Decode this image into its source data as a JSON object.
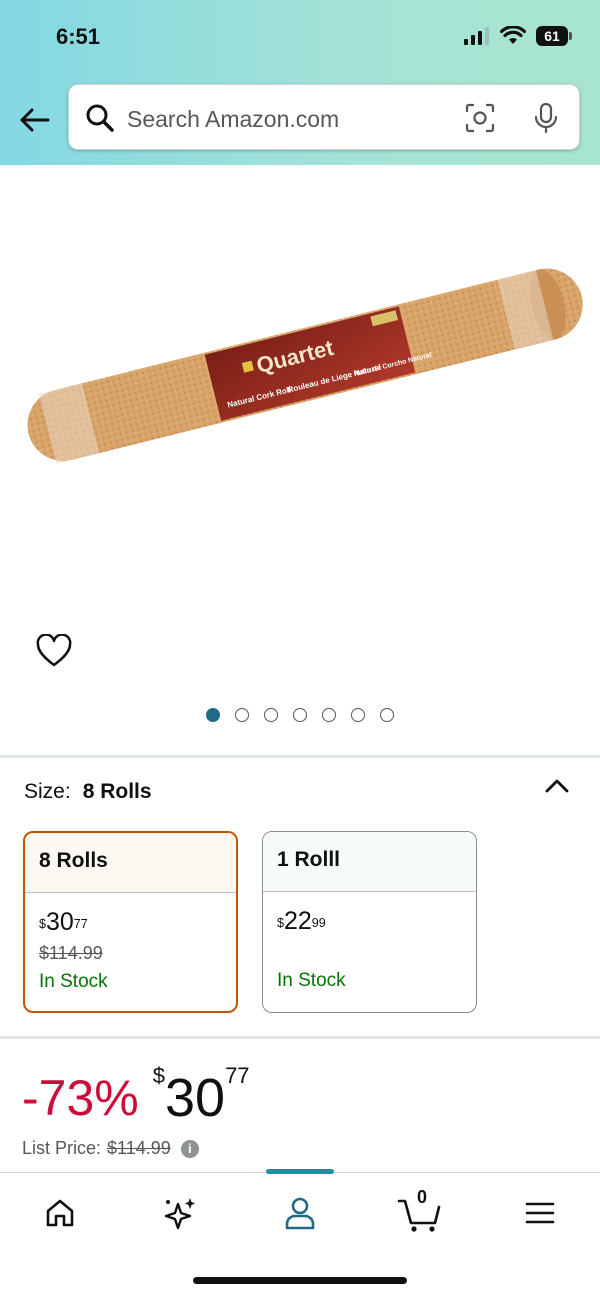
{
  "status_bar": {
    "time": "6:51",
    "battery": "61"
  },
  "search": {
    "placeholder": "Search Amazon.com"
  },
  "product": {
    "image_alt": "Quartet Natural Cork Roll",
    "image_brand": "Quartet",
    "image_text_en": "Natural Cork Roll",
    "image_text_fr": "Rouleau de Liege Naturel",
    "image_text_es": "Rollo de Corcho Natural",
    "gallery_total": 7,
    "gallery_active": 1
  },
  "size": {
    "label": "Size:",
    "value": "8 Rolls",
    "options": [
      {
        "name": "8 Rolls",
        "price_dollars": "30",
        "price_cents": "77",
        "list_price": "$114.99",
        "availability": "In Stock",
        "selected": true
      },
      {
        "name": "1 Rolll",
        "price_dollars": "22",
        "price_cents": "99",
        "list_price": "",
        "availability": "In Stock",
        "selected": false
      }
    ]
  },
  "deal": {
    "discount": "-73%",
    "currency": "$",
    "price_dollars": "30",
    "price_cents": "77",
    "list_price_label": "List Price:",
    "list_price": "$114.99",
    "info_icon": "i"
  },
  "bottom_nav": {
    "items": [
      "home-icon",
      "sparkle-icon",
      "account-icon",
      "cart-icon",
      "menu-icon"
    ],
    "active": "account-icon",
    "cart_count": "0"
  },
  "colors": {
    "header_gradient_start": "#82d8e3",
    "header_gradient_end": "#a8e5cf",
    "discount_red": "#cc0c39",
    "in_stock_green": "#007600",
    "selected_border": "#c45500",
    "active_teal": "#1f6b85"
  }
}
